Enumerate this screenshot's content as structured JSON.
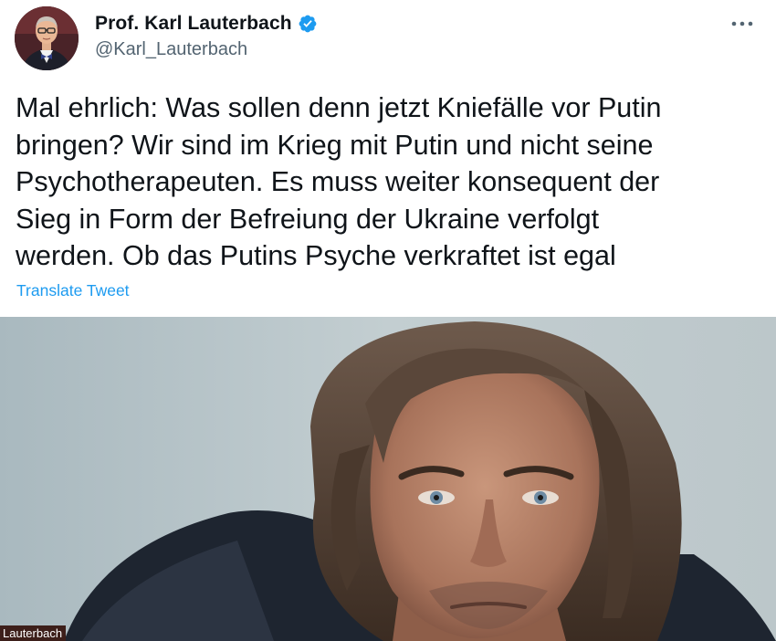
{
  "author": {
    "display_name": "Prof. Karl Lauterbach",
    "handle": "@Karl_Lauterbach",
    "verified": true,
    "avatar_icon": "profile-photo"
  },
  "tweet": {
    "text": "Mal ehrlich: Was sollen denn jetzt Kniefälle vor Putin\nbringen? Wir sind im Krieg mit Putin und nicht seine\nPsychotherapeuten. Es muss weiter konsequent der\nSieg in Form der Befreiung der Ukraine verfolgt\nwerden. Ob das Putins Psyche verkraftet ist egal",
    "translate_label": "Translate Tweet"
  },
  "media": {
    "caption": "Lauterbach",
    "icon": "portrait-photo"
  },
  "menu": {
    "more_icon": "more-horizontal-icon"
  },
  "colors": {
    "text_primary": "#0f1419",
    "text_secondary": "#536471",
    "accent": "#1d9bf0"
  }
}
